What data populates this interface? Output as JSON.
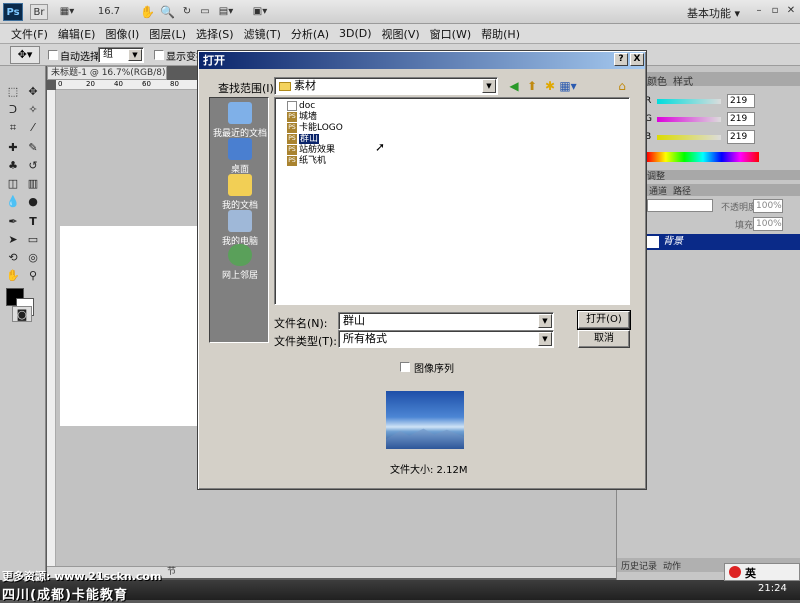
{
  "app": {
    "logo_text": "Ps",
    "br_label": "Br",
    "zoom_value": "16.7",
    "workspace": "基本功能",
    "menu": [
      "文件(F)",
      "编辑(E)",
      "图像(I)",
      "图层(L)",
      "选择(S)",
      "滤镜(T)",
      "分析(A)",
      "3D(D)",
      "视图(V)",
      "窗口(W)",
      "帮助(H)"
    ]
  },
  "options_bar": {
    "auto_select_label": "自动选择:",
    "auto_select_value": "组",
    "show_transform_label": "显示变换"
  },
  "document": {
    "tab_title": "未标题-1 @ 16.7%(RGB/8)",
    "ruler_ticks": [
      "0",
      "20",
      "40",
      "60",
      "80"
    ],
    "status_fragment": "节"
  },
  "panels": {
    "color_tabs": [
      "颜色",
      "样式"
    ],
    "swatch_tab": "调整",
    "layers_tabs": [
      "通道",
      "路径"
    ],
    "opacity_label": "不透明度:",
    "opacity_value": "100%",
    "fill_label": "填充:",
    "fill_value": "100%",
    "channel_labels": [
      "R",
      "G",
      "B"
    ],
    "channel_values": [
      "219",
      "219",
      "219"
    ],
    "layer_name": "背景",
    "history_tabs": [
      "历史记录",
      "动作"
    ]
  },
  "dialog": {
    "title": "打开",
    "help_btn": "?",
    "close_btn": "X",
    "look_in_label": "查找范围(I):",
    "look_in_value": "素材",
    "places": [
      "我最近的文档",
      "桌面",
      "我的文档",
      "我的电脑",
      "网上邻居"
    ],
    "files": [
      {
        "name": "doc",
        "selected": false
      },
      {
        "name": "城墙",
        "selected": false
      },
      {
        "name": "卡能LOGO",
        "selected": false
      },
      {
        "name": "群山",
        "selected": true
      },
      {
        "name": "站舫效果",
        "selected": false
      },
      {
        "name": "纸飞机",
        "selected": false
      }
    ],
    "filename_label": "文件名(N):",
    "filename_value": "群山",
    "filetype_label": "文件类型(T):",
    "filetype_value": "所有格式",
    "open_button": "打开(O)",
    "cancel_button": "取消",
    "image_sequence_label": "图像序列",
    "file_size": "文件大小: 2.12M"
  },
  "overlay": {
    "watermark_line1": "更多资源: www.21sckn.com",
    "watermark_line2": "四川(成都)卡能教育",
    "tray_label": "英",
    "clock": "21:24"
  }
}
